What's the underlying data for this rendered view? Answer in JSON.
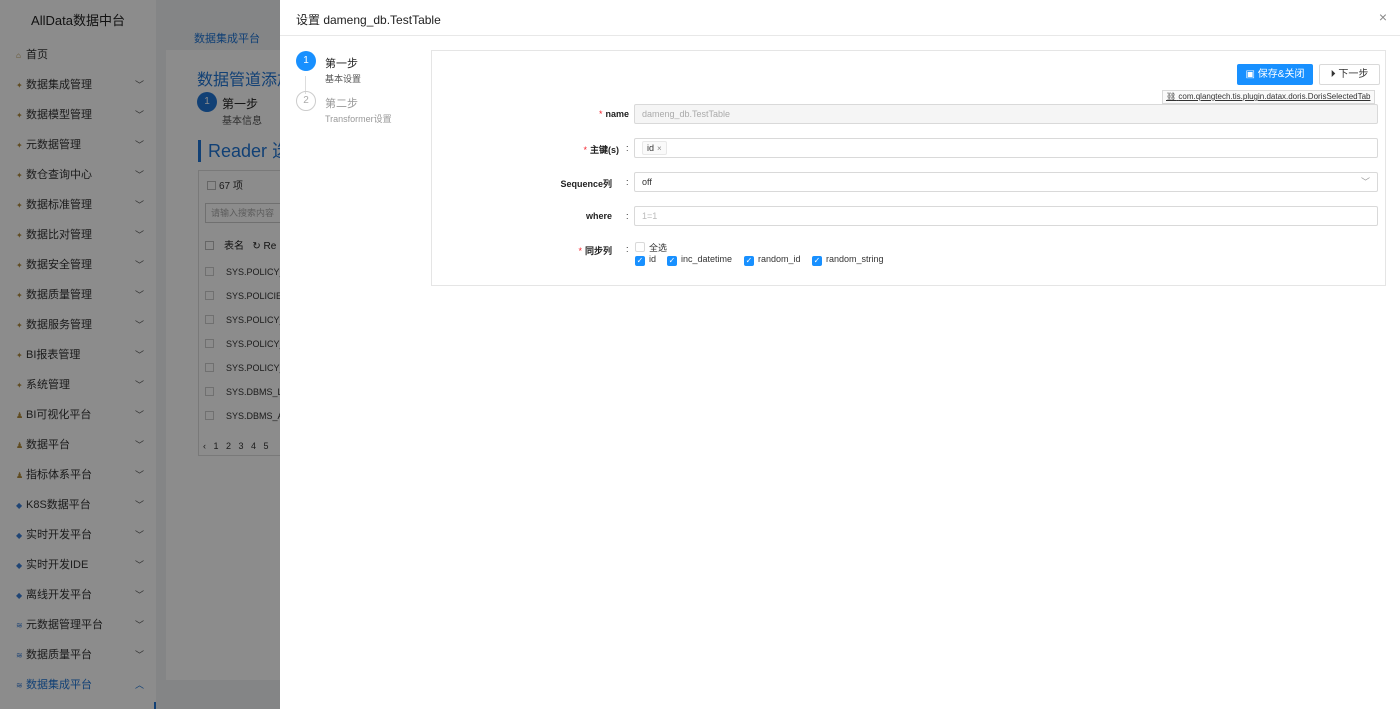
{
  "app_title": "AllData数据中台",
  "sidebar": {
    "items": [
      {
        "label": "首页",
        "icon": "home-icon",
        "has_chevron": false,
        "active": false
      },
      {
        "label": "数据集成管理",
        "icon": "module-icon",
        "has_chevron": true,
        "active": false
      },
      {
        "label": "数据模型管理",
        "icon": "module-icon",
        "has_chevron": true,
        "active": false
      },
      {
        "label": "元数据管理",
        "icon": "module-icon",
        "has_chevron": true,
        "active": false
      },
      {
        "label": "数仓查询中心",
        "icon": "module-icon",
        "has_chevron": true,
        "active": false
      },
      {
        "label": "数据标准管理",
        "icon": "module-icon",
        "has_chevron": true,
        "active": false
      },
      {
        "label": "数据比对管理",
        "icon": "module-icon",
        "has_chevron": true,
        "active": false
      },
      {
        "label": "数据安全管理",
        "icon": "module-icon",
        "has_chevron": true,
        "active": false
      },
      {
        "label": "数据质量管理",
        "icon": "module-icon",
        "has_chevron": true,
        "active": false
      },
      {
        "label": "数据服务管理",
        "icon": "module-icon",
        "has_chevron": true,
        "active": false
      },
      {
        "label": "BI报表管理",
        "icon": "module-icon",
        "has_chevron": true,
        "active": false
      },
      {
        "label": "系统管理",
        "icon": "module-icon",
        "has_chevron": true,
        "active": false
      },
      {
        "label": "BI可视化平台",
        "icon": "person-icon",
        "has_chevron": true,
        "active": false
      },
      {
        "label": "数据平台",
        "icon": "person-icon",
        "has_chevron": true,
        "active": false
      },
      {
        "label": "指标体系平台",
        "icon": "person-icon",
        "has_chevron": true,
        "active": false
      },
      {
        "label": "K8S数据平台",
        "icon": "diamond-icon",
        "has_chevron": true,
        "active": false
      },
      {
        "label": "实时开发平台",
        "icon": "diamond-icon",
        "has_chevron": true,
        "active": false
      },
      {
        "label": "实时开发IDE",
        "icon": "diamond-icon",
        "has_chevron": true,
        "active": false
      },
      {
        "label": "离线开发平台",
        "icon": "diamond-icon",
        "has_chevron": true,
        "active": false
      },
      {
        "label": "元数据管理平台",
        "icon": "layers-icon",
        "has_chevron": true,
        "active": false
      },
      {
        "label": "数据质量平台",
        "icon": "layers-icon",
        "has_chevron": true,
        "active": false
      },
      {
        "label": "数据集成平台",
        "icon": "layers-icon",
        "has_chevron": true,
        "active": true
      }
    ]
  },
  "background": {
    "topnav_label": "数据集成平台",
    "page_heading": "数据管道添加",
    "step1_title": "第一步",
    "step1_sub": "基本信息",
    "reader_heading": "Reader 选",
    "table": {
      "count": "67 项",
      "search_placeholder": "请输入搜索内容",
      "header_label": "表名",
      "header_extra": "Re",
      "rows": [
        "SYS.POLICY_",
        "SYS.POLICIE",
        "SYS.POLICY_",
        "SYS.POLICY_",
        "SYS.POLICY_",
        "SYS.DBMS_L",
        "SYS.DBMS_A"
      ],
      "pager": "‹ 1 2 3 4 5"
    }
  },
  "drawer": {
    "title": "设置 dameng_db.TestTable",
    "steps": [
      {
        "number": "1",
        "title": "第一步",
        "subtitle": "基本设置",
        "status": "active"
      },
      {
        "number": "2",
        "title": "第二步",
        "subtitle": "Transformer设置",
        "status": "wait"
      }
    ],
    "save_close_label": "保存&关闭",
    "next_label": "下一步",
    "plugin_link": "com.qlangtech.tis.plugin.datax.doris.DorisSelectedTab",
    "form": {
      "name_label": "name",
      "name_value": "dameng_db.TestTable",
      "pk_label": "主键(s)",
      "pk_tag": "id",
      "sequence_label": "Sequence列",
      "sequence_value": "off",
      "where_label": "where",
      "where_placeholder": "1=1",
      "sync_label": "同步列",
      "select_all_label": "全选",
      "columns": [
        {
          "label": "id",
          "checked": true
        },
        {
          "label": "inc_datetime",
          "checked": true
        },
        {
          "label": "random_id",
          "checked": true
        },
        {
          "label": "random_string",
          "checked": true
        }
      ]
    }
  },
  "colors": {
    "accent": "#1890ff",
    "required": "#f5222d",
    "sidebar_active": "#1f75d6"
  }
}
